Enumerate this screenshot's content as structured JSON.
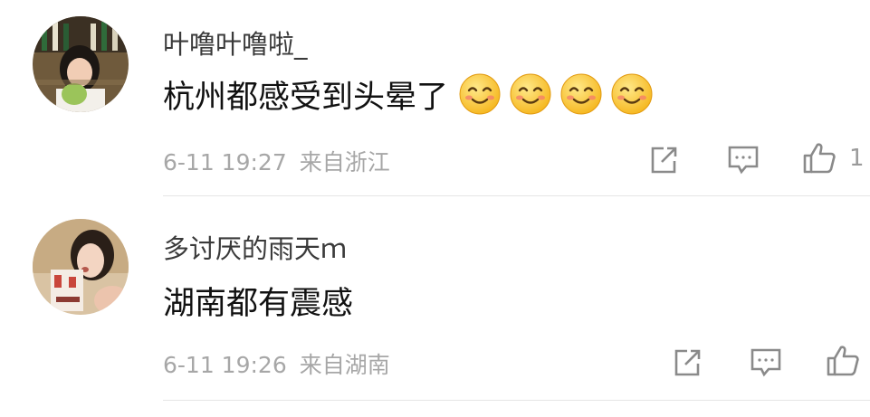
{
  "comments": [
    {
      "username": "叶噜叶噜啦_",
      "text": "杭州都感受到头晕了",
      "emoji_count": 4,
      "emoji_icon": "smile-emoji-icon",
      "time": "6-11 19:27",
      "location": "来自浙江",
      "like_count": "1"
    },
    {
      "username": "多讨厌的雨天ｍ",
      "text": "湖南都有震感",
      "time": "6-11 19:26",
      "location": "来自湖南",
      "like_count": ""
    }
  ],
  "icons": {
    "share": "share-icon",
    "comment": "comment-icon",
    "like": "thumbs-up-icon"
  },
  "colors": {
    "meta_text": "#a7a7a7",
    "icon_stroke": "#8a8a8a",
    "divider": "#e6e6e6"
  }
}
